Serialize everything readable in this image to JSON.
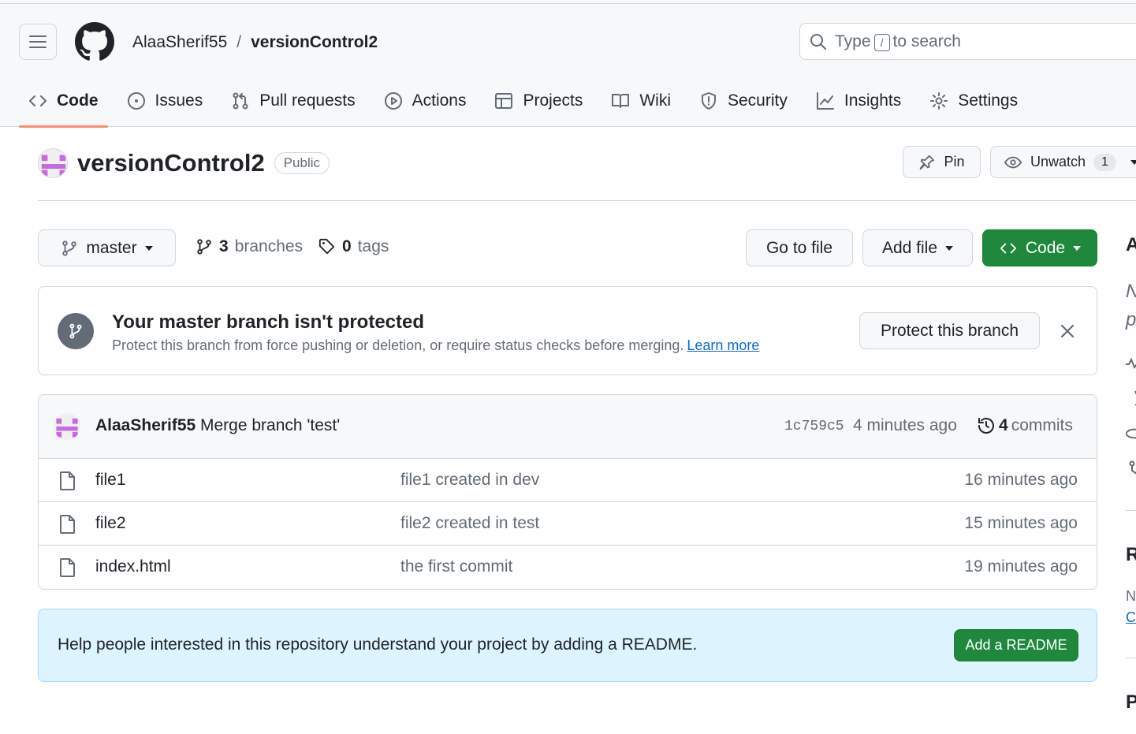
{
  "header": {
    "owner": "AlaaSherif55",
    "separator": "/",
    "repo": "versionControl2",
    "search": {
      "prefix": "Type",
      "key": "/",
      "suffix": "to search"
    }
  },
  "tabs": [
    {
      "label": "Code",
      "icon": "code-icon",
      "active": true
    },
    {
      "label": "Issues",
      "icon": "issue-icon"
    },
    {
      "label": "Pull requests",
      "icon": "pull-request-icon"
    },
    {
      "label": "Actions",
      "icon": "play-icon"
    },
    {
      "label": "Projects",
      "icon": "table-icon"
    },
    {
      "label": "Wiki",
      "icon": "book-icon"
    },
    {
      "label": "Security",
      "icon": "shield-icon"
    },
    {
      "label": "Insights",
      "icon": "graph-icon"
    },
    {
      "label": "Settings",
      "icon": "gear-icon"
    }
  ],
  "repo": {
    "title": "versionControl2",
    "visibility": "Public",
    "pin_label": "Pin",
    "watch_label": "Unwatch",
    "watch_count": "1"
  },
  "branch_bar": {
    "branch": "master",
    "branches_count": "3",
    "branches_label": "branches",
    "tags_count": "0",
    "tags_label": "tags",
    "goto_label": "Go to file",
    "add_file_label": "Add file",
    "code_label": "Code"
  },
  "protect_banner": {
    "title": "Your master branch isn't protected",
    "description": "Protect this branch from force pushing or deletion, or require status checks before merging.",
    "link": "Learn more",
    "button": "Protect this branch"
  },
  "latest_commit": {
    "author": "AlaaSherif55",
    "message": "Merge branch 'test'",
    "sha": "1c759c5",
    "time": "4 minutes ago",
    "commit_count": "4",
    "commit_label": "commits"
  },
  "files": [
    {
      "name": "file1",
      "message": "file1 created in dev",
      "time": "16 minutes ago"
    },
    {
      "name": "file2",
      "message": "file2 created in test",
      "time": "15 minutes ago"
    },
    {
      "name": "index.html",
      "message": "the first commit",
      "time": "19 minutes ago"
    }
  ],
  "readme_banner": {
    "text": "Help people interested in this repository understand your project by adding a README.",
    "button": "Add a README"
  },
  "sidebar_fragments": {
    "about_initial": "A",
    "desc_initial_1": "N",
    "desc_initial_2": "p",
    "releases_initial": "R",
    "releases_note_initial": "N",
    "releases_link_initial": "C",
    "packages_initial": "P"
  },
  "colors": {
    "accent_green": "#1f883d",
    "link_blue": "#0969da",
    "tab_underline": "#fd8c73",
    "readme_bg": "#ddf4ff"
  }
}
